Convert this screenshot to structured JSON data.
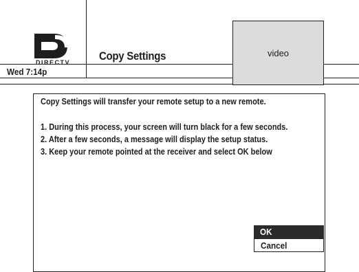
{
  "header": {
    "logo_text": "DIRECTV",
    "title": "Copy Settings",
    "time": "Wed 7:14p",
    "video_label": "video"
  },
  "dialog": {
    "intro": "Copy Settings will transfer your remote setup to a new remote.",
    "steps": [
      "1. During this process, your screen will turn black for a few seconds.",
      "2. After a few seconds, a message will display the setup status.",
      "3. Keep your remote pointed at the receiver and select OK below"
    ],
    "options": [
      {
        "label": "OK",
        "selected": true
      },
      {
        "label": "Cancel",
        "selected": false
      }
    ]
  },
  "colors": {
    "line": "#1e1e1e",
    "selected_bg": "#2b2b2b",
    "video_bg": "#dcdcdc"
  }
}
